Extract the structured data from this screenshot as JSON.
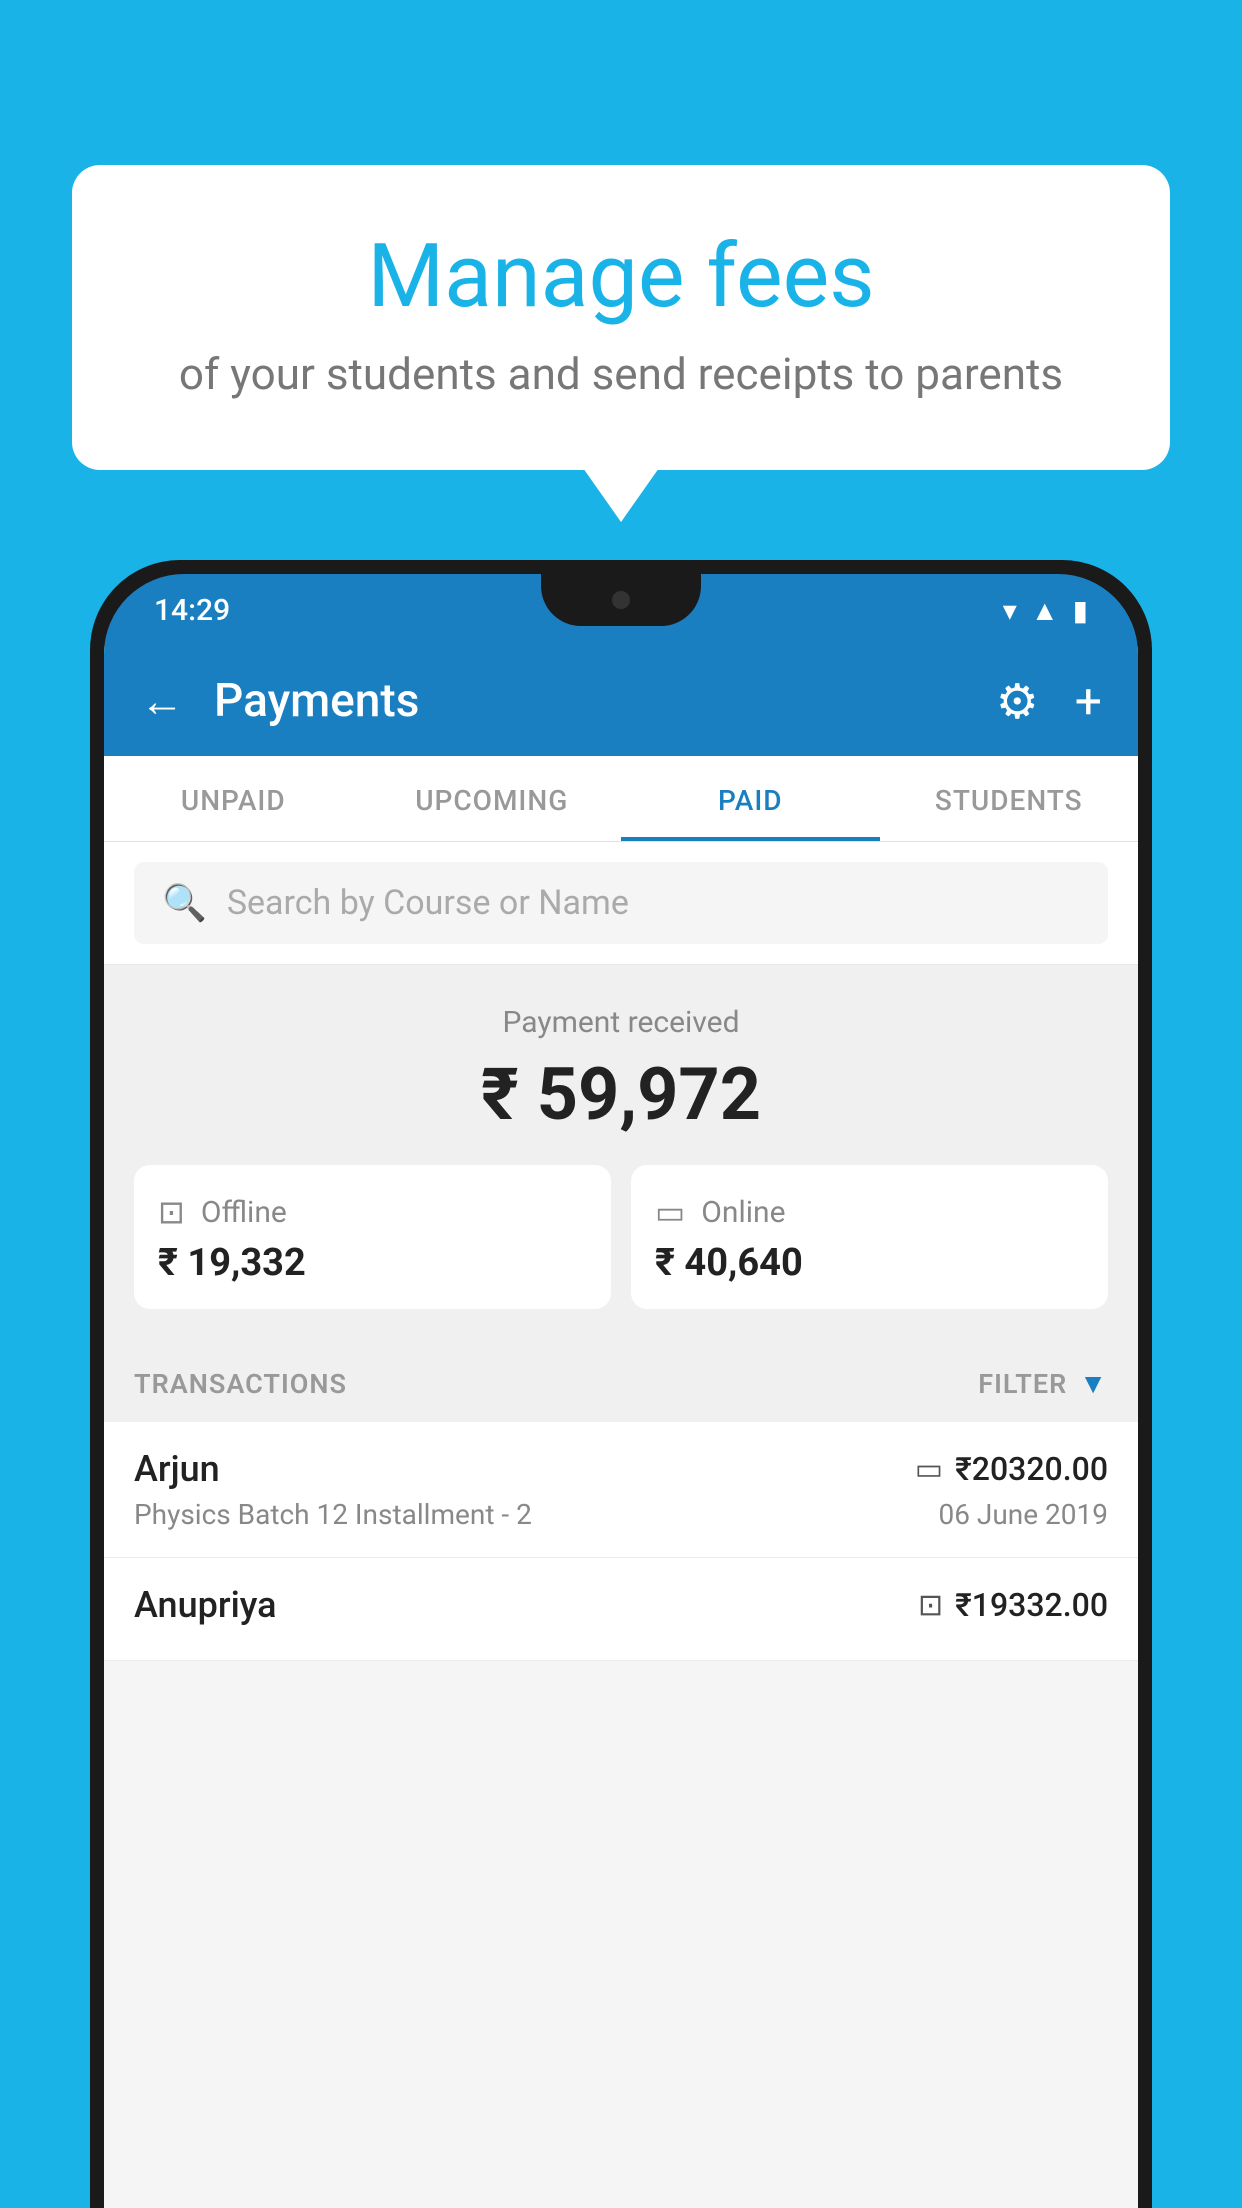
{
  "background_color": "#1ab3e8",
  "speech_bubble": {
    "title": "Manage fees",
    "subtitle": "of your students and send receipts to parents"
  },
  "status_bar": {
    "time": "14:29"
  },
  "toolbar": {
    "title": "Payments",
    "back_label": "←",
    "gear_label": "⚙",
    "plus_label": "+"
  },
  "tabs": [
    {
      "label": "UNPAID",
      "active": false
    },
    {
      "label": "UPCOMING",
      "active": false
    },
    {
      "label": "PAID",
      "active": true
    },
    {
      "label": "STUDENTS",
      "active": false
    }
  ],
  "search": {
    "placeholder": "Search by Course or Name"
  },
  "payment_summary": {
    "label": "Payment received",
    "total": "₹ 59,972",
    "offline": {
      "label": "Offline",
      "amount": "₹ 19,332"
    },
    "online": {
      "label": "Online",
      "amount": "₹ 40,640"
    }
  },
  "transactions_section": {
    "label": "TRANSACTIONS",
    "filter_label": "FILTER"
  },
  "transactions": [
    {
      "name": "Arjun",
      "amount": "₹20320.00",
      "course": "Physics Batch 12 Installment - 2",
      "date": "06 June 2019",
      "payment_type": "online"
    },
    {
      "name": "Anupriya",
      "amount": "₹19332.00",
      "course": "",
      "date": "",
      "payment_type": "offline"
    }
  ]
}
